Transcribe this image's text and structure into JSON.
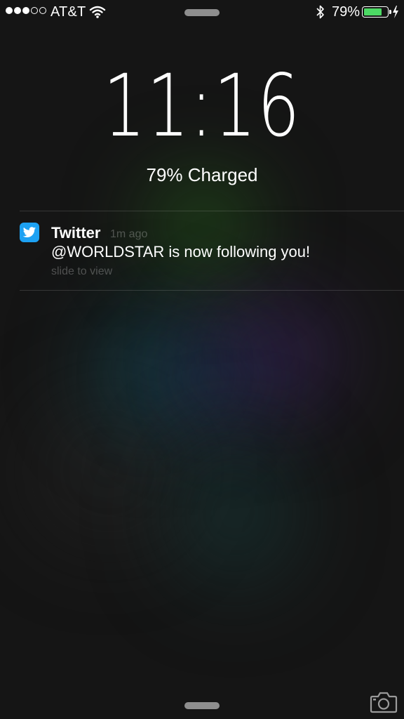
{
  "status_bar": {
    "signal_bars_filled": 3,
    "signal_bars_total": 5,
    "carrier": "AT&T",
    "wifi_icon": "wifi-icon",
    "bluetooth_icon": "bluetooth-icon",
    "battery_percent": "79%",
    "battery_level": 0.79,
    "battery_color": "#4cd964",
    "charging_icon": "charging-bolt-icon"
  },
  "lock_screen": {
    "time": "11:16",
    "charge_status": "79% Charged"
  },
  "notification": {
    "app_icon": "twitter-bird-icon",
    "app_icon_color": "#1da1f2",
    "app_name": "Twitter",
    "time_ago": "1m ago",
    "message": "@WORLDSTAR is now following you!",
    "action_hint": "slide to view"
  },
  "bottom": {
    "camera_icon": "camera-icon"
  }
}
